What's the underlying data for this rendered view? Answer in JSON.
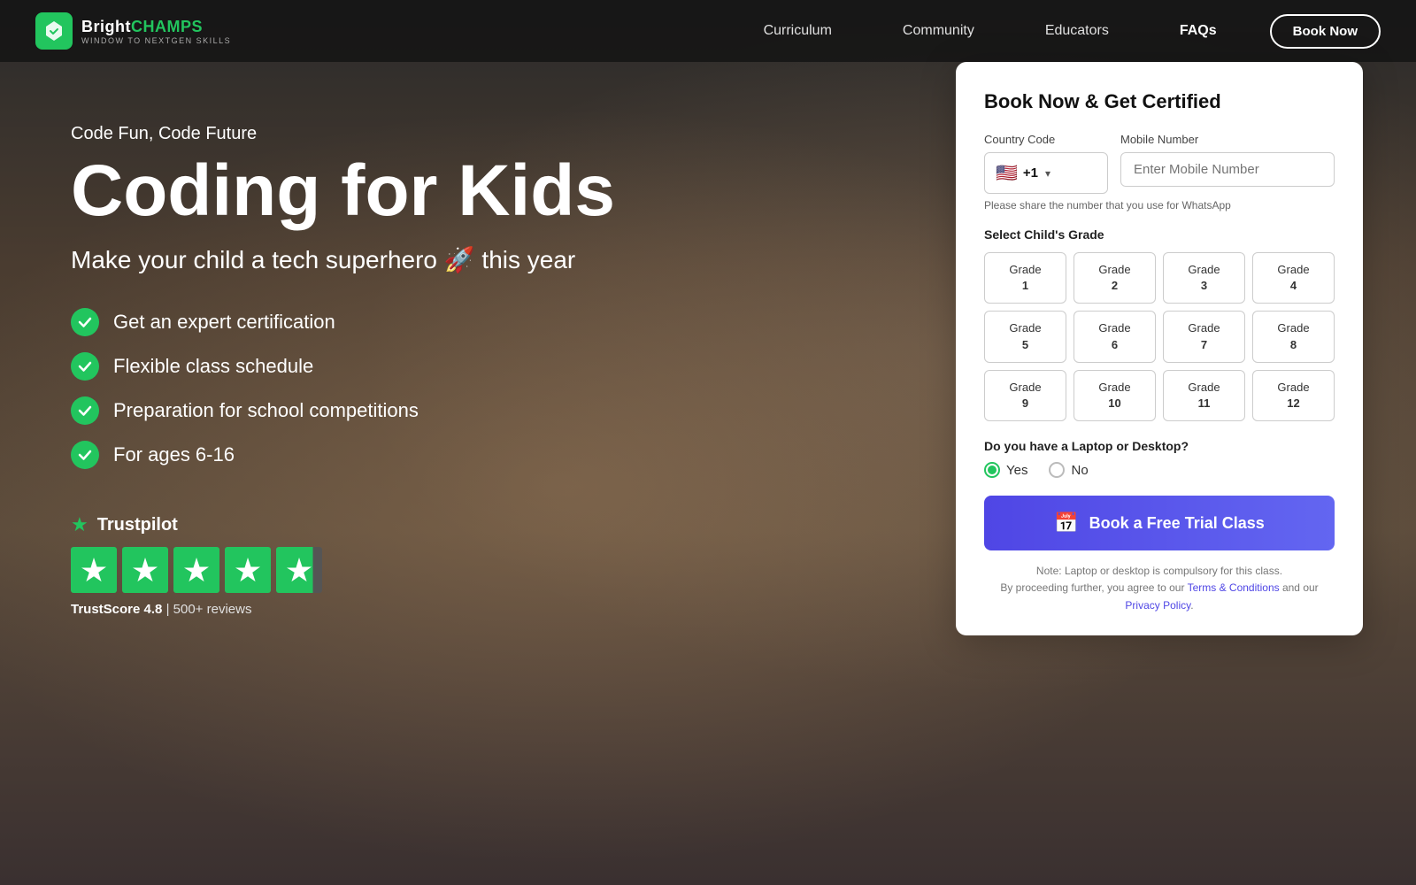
{
  "site": {
    "logo_brand": "BrightCHAMPS",
    "logo_tagline": "WINDOW TO NEXTGEN SKILLS"
  },
  "nav": {
    "links": [
      {
        "label": "Curriculum",
        "active": false
      },
      {
        "label": "Community",
        "active": false
      },
      {
        "label": "Educators",
        "active": false
      },
      {
        "label": "FAQs",
        "active": true
      }
    ],
    "book_now_label": "Book Now"
  },
  "hero": {
    "tagline_small": "Code Fun, Code Future",
    "title": "Coding for Kids",
    "subtitle": "Make your child a tech superhero 🚀 this year",
    "features": [
      "Get an expert certification",
      "Flexible class schedule",
      "Preparation for school competitions",
      "For ages 6-16"
    ],
    "trustpilot_brand": "Trustpilot",
    "trust_score_label": "TrustScore",
    "trust_score": "4.8",
    "trust_separator": "|",
    "trust_reviews": "500+ reviews"
  },
  "form": {
    "title": "Book Now & Get Certified",
    "country_code_label": "Country Code",
    "mobile_label": "Mobile Number",
    "mobile_placeholder": "Enter Mobile Number",
    "whatsapp_hint": "Please share the number that you use for WhatsApp",
    "grade_label": "Select Child's Grade",
    "grades": [
      {
        "label": "Grade",
        "num": "1"
      },
      {
        "label": "Grade",
        "num": "2"
      },
      {
        "label": "Grade",
        "num": "3"
      },
      {
        "label": "Grade",
        "num": "4"
      },
      {
        "label": "Grade",
        "num": "5"
      },
      {
        "label": "Grade",
        "num": "6"
      },
      {
        "label": "Grade",
        "num": "7"
      },
      {
        "label": "Grade",
        "num": "8"
      },
      {
        "label": "Grade",
        "num": "9"
      },
      {
        "label": "Grade",
        "num": "10"
      },
      {
        "label": "Grade",
        "num": "11"
      },
      {
        "label": "Grade",
        "num": "12"
      }
    ],
    "laptop_label": "Do you have a Laptop or Desktop?",
    "radio_yes": "Yes",
    "radio_no": "No",
    "radio_selected": "Yes",
    "btn_trial_label": "Book a Free Trial Class",
    "note_line1": "Note: Laptop or desktop is compulsory for this class.",
    "note_line2": "By proceeding further, you agree to our Terms & Conditions and our Privacy Policy.",
    "terms_label": "Terms & Conditions",
    "privacy_label": "Privacy Policy",
    "country_flag": "🇺🇸",
    "country_code": "+1"
  }
}
